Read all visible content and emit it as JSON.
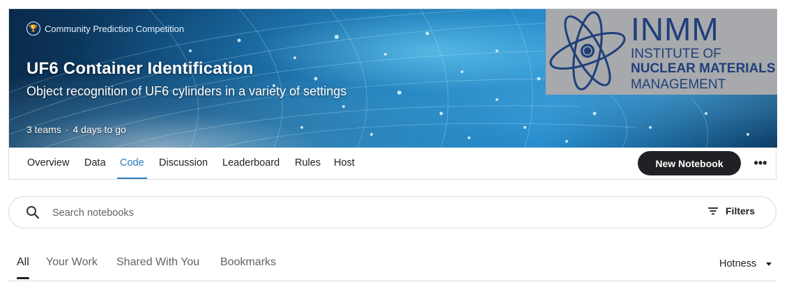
{
  "competition": {
    "type_label": "Community Prediction Competition",
    "title": "UF6 Container Identification",
    "subtitle": "Object recognition of UF6 cylinders in a variety of settings",
    "teams": "3 teams",
    "separator": "·",
    "deadline": "4 days to go"
  },
  "host_logo": {
    "acronym": "INMM",
    "line1": "INSTITUTE OF",
    "line2": "NUCLEAR MATERIALS",
    "line3": "MANAGEMENT",
    "background": "#a7a9ac",
    "color": "#1f3f7a"
  },
  "tabs": [
    {
      "label": "Overview"
    },
    {
      "label": "Data"
    },
    {
      "label": "Code",
      "active": true
    },
    {
      "label": "Discussion"
    },
    {
      "label": "Leaderboard"
    },
    {
      "label": "Rules"
    },
    {
      "label": "Host"
    }
  ],
  "actions": {
    "new_notebook": "New Notebook",
    "more_icon": "more-horizontal-icon"
  },
  "search": {
    "placeholder": "Search notebooks",
    "value": "",
    "icon": "search-icon",
    "filters_label": "Filters",
    "filters_icon": "filter-icon"
  },
  "subtabs": [
    {
      "label": "All",
      "active": true
    },
    {
      "label": "Your Work"
    },
    {
      "label": "Shared With You"
    },
    {
      "label": "Bookmarks"
    }
  ],
  "sort": {
    "selected": "Hotness"
  },
  "colors": {
    "accent": "#2a7bb8",
    "button_dark": "#202124"
  }
}
